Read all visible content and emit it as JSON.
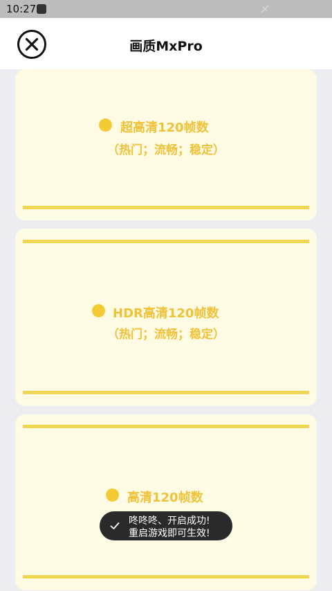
{
  "status_bar": {
    "time": "10:27"
  },
  "app_bar": {
    "title": "画质MxPro"
  },
  "options": [
    {
      "label": "超高清120帧数",
      "tags": "（热门；流畅；稳定）"
    },
    {
      "label": "HDR高清120帧数",
      "tags": "（热门；流畅；稳定）"
    },
    {
      "label": "高清120帧数",
      "tags": ""
    }
  ],
  "toast": {
    "line1": "咚咚咚、开启成功!",
    "line2": "重启游戏即可生效!"
  },
  "colors": {
    "accent": "#f0c23a",
    "line": "#f0d654",
    "card": "#fefbe4"
  }
}
